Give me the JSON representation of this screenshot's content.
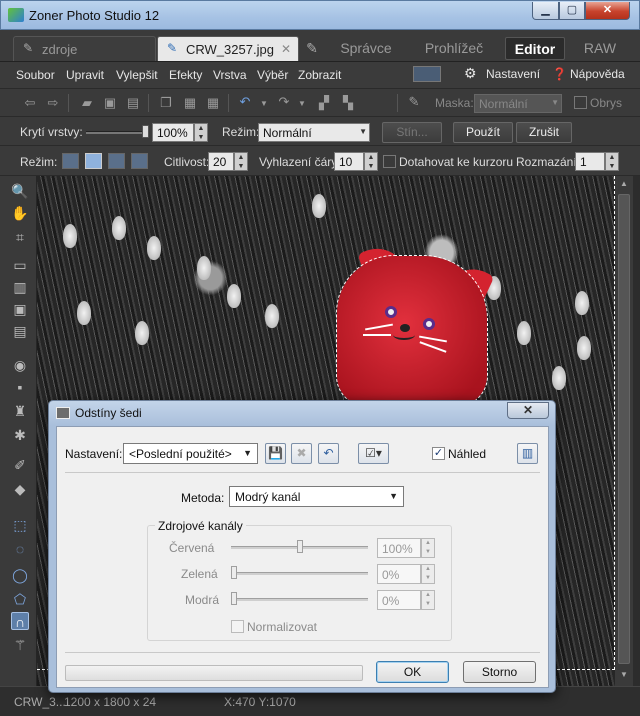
{
  "window": {
    "title": "Zoner Photo Studio 12"
  },
  "tabs": [
    {
      "label": "zdroje"
    },
    {
      "label": "CRW_3257.jpg"
    }
  ],
  "modes": {
    "spravce": "Správce",
    "prohlizec": "Prohlížeč",
    "editor": "Editor",
    "raw": "RAW"
  },
  "menu": [
    "Soubor",
    "Upravit",
    "Vylepšit",
    "Efekty",
    "Vrstva",
    "Výběr",
    "Zobrazit"
  ],
  "menu_right": {
    "settings": "Nastavení",
    "help": "Nápověda"
  },
  "toolbar1": {
    "mask_label": "Maska:",
    "mask_value": "Normální",
    "outline_label": "Obrys"
  },
  "toolbar2": {
    "opacity_label": "Krytí vrstvy:",
    "opacity_value": "100%",
    "opacity_percent": 100,
    "mode_label": "Režim:",
    "mode_value": "Normální",
    "shadow_button": "Stín...",
    "apply_button": "Použít",
    "cancel_button": "Zrušit"
  },
  "toolbar3": {
    "mode_label": "Režim:",
    "sensitivity_label": "Citlivost:",
    "sensitivity_value": "20",
    "smoothing_label": "Vyhlazení čáry:",
    "smoothing_value": "10",
    "snap_label": "Dotahovat ke kurzoru",
    "blur_label": "Rozmazání:",
    "blur_value": "1"
  },
  "status": {
    "file": "CRW_3...",
    "dims": "1200 x 1800 x 24",
    "coords": "X:470  Y:1070"
  },
  "dialog": {
    "title": "Odstíny šedi",
    "preset_label": "Nastavení:",
    "preset_value": "<Poslední použité>",
    "preview_label": "Náhled",
    "preview_checked": true,
    "method_label": "Metoda:",
    "method_value": "Modrý kanál",
    "group_label": "Zdrojové kanály",
    "channels": [
      {
        "label": "Červená",
        "value": "100%",
        "percent": 100
      },
      {
        "label": "Zelená",
        "value": "0%",
        "percent": 0
      },
      {
        "label": "Modrá",
        "value": "0%",
        "percent": 0
      }
    ],
    "normalize_label": "Normalizovat",
    "ok_button": "OK",
    "cancel_button": "Storno"
  }
}
